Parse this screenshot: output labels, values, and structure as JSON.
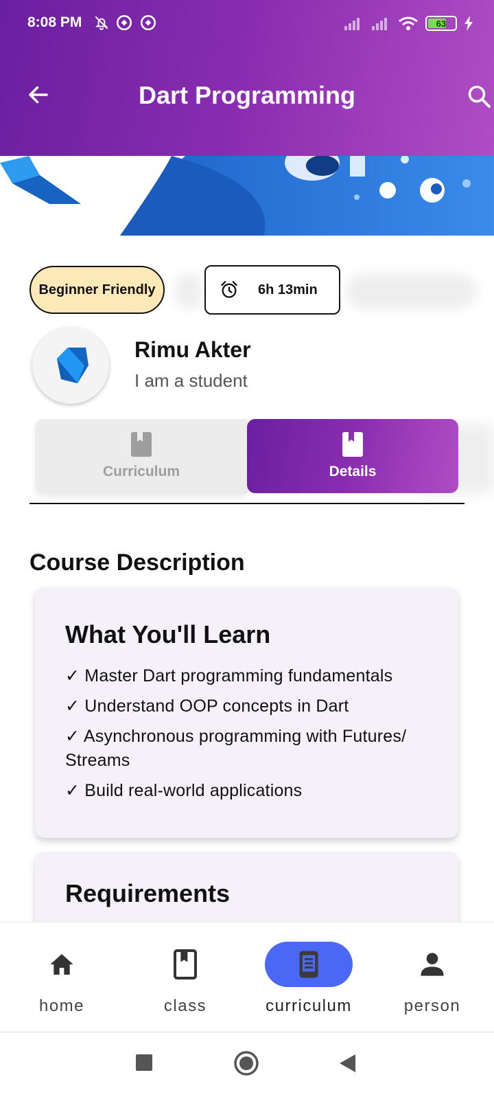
{
  "status_bar": {
    "time": "8:08 PM",
    "battery": "63"
  },
  "app_bar": {
    "title": "Dart Programming",
    "icons": [
      "back-arrow-icon",
      "search-icon"
    ]
  },
  "chips": {
    "level": "Beginner Friendly",
    "duration": "6h 13min"
  },
  "profile": {
    "name": "Rimu Akter",
    "role": "I am a student"
  },
  "tabs": [
    {
      "label": "Curriculum",
      "icon": "book-icon",
      "selected": false
    },
    {
      "label": "Details",
      "icon": "book-icon",
      "selected": true
    }
  ],
  "content": {
    "section_title": "Course Description",
    "learn_card": {
      "title": "What You'll Learn",
      "items": [
        "✓ Master Dart programming fundamentals",
        "✓ Understand OOP concepts in Dart",
        "✓ Asynchronous programming with Futures/ Streams",
        "✓ Build real-world applications"
      ]
    },
    "requirements_card": {
      "title": "Requirements"
    }
  },
  "bottom_nav": [
    {
      "label": "home",
      "icon": "home-icon",
      "active": false
    },
    {
      "label": "class",
      "icon": "book-icon",
      "active": false
    },
    {
      "label": "curriculum",
      "icon": "tablet-icon",
      "active": true
    },
    {
      "label": "person",
      "icon": "person-icon",
      "active": false
    }
  ],
  "colors": {
    "gradient_start": "#6a1fa0",
    "gradient_end": "#b04dc4",
    "chip_beginner_bg": "#fde9b8",
    "nav_active": "#4a67f5",
    "card_bg": "#f4f1f8"
  }
}
